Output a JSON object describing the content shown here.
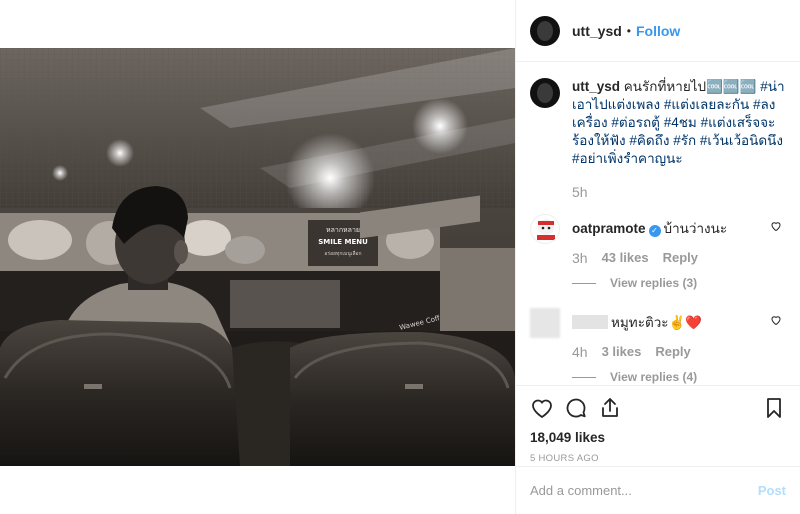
{
  "post": {
    "author": "utt_ysd",
    "follow_label": "Follow",
    "caption_user": "utt_ysd",
    "caption_text": " คนรักที่หายไป🆒🆒🆒 ",
    "hashtags": [
      "#น่าเอาไปแต่งเพลง",
      "#แต่งเลยละกัน",
      "#ลงเครื่อง",
      "#ต่อรถตู้",
      "#4ชม",
      "#แต่งเสร็จจะร้องให้ฟัง",
      "#คิดถึง",
      "#รัก",
      "#เว้นเว้อนิดนึง",
      "#อย่าเพิ่งรำคาญนะ"
    ],
    "caption_time": "5h",
    "likes": "18,049 likes",
    "posted_ago": "5 HOURS AGO",
    "add_comment_placeholder": "Add a comment...",
    "post_label": "Post"
  },
  "comments": [
    {
      "user": "oatpramote",
      "verified": true,
      "text": "บ้านว่างนะ",
      "time": "3h",
      "likes": "43 likes",
      "reply_label": "Reply",
      "view_replies": "View replies (3)"
    },
    {
      "user": "",
      "verified": false,
      "text": "หมูทะติวะ✌️❤️",
      "time": "4h",
      "likes": "3 likes",
      "reply_label": "Reply",
      "view_replies": "View replies (4)"
    }
  ],
  "photo": {
    "sign_title": "หลากหลาย",
    "sign_subtitle": "SMILE MENU",
    "sign_line": "อร่อยทุกเมนูเลือก",
    "shop_sign": "Wawee Coffee"
  },
  "icons": {
    "like": "heart-icon",
    "comment": "comment-icon",
    "share": "share-icon",
    "save": "bookmark-icon"
  }
}
